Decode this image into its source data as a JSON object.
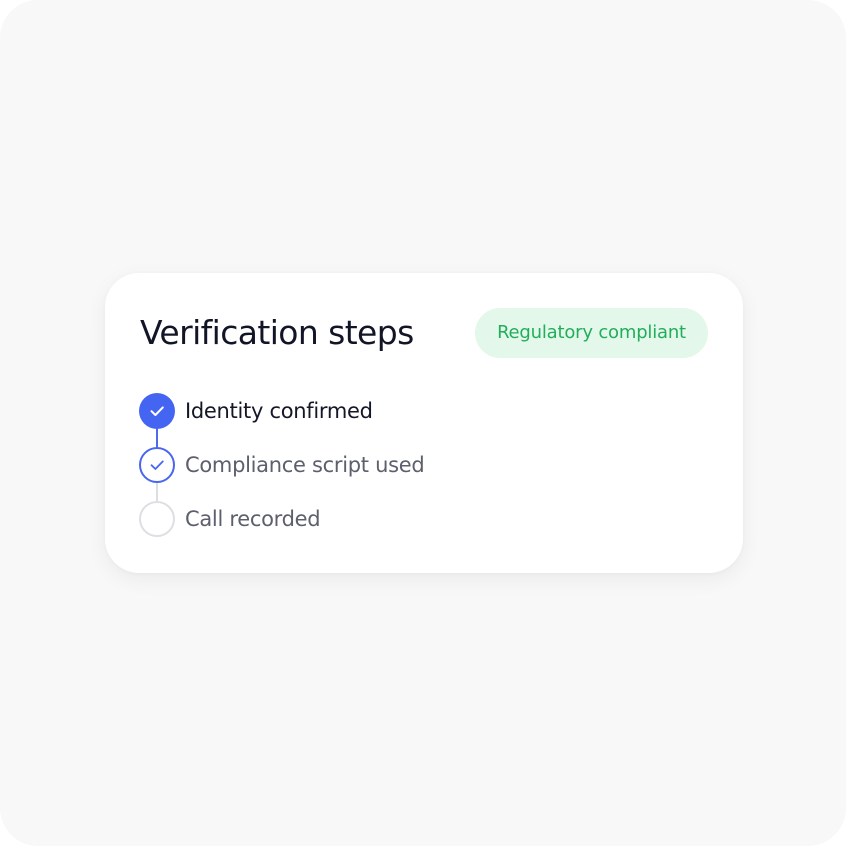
{
  "card": {
    "title": "Verification steps",
    "badge": "Regulatory compliant"
  },
  "steps": [
    {
      "label": "Identity confirmed",
      "status": "completed"
    },
    {
      "label": "Compliance script used",
      "status": "checked"
    },
    {
      "label": "Call recorded",
      "status": "pending"
    }
  ],
  "colors": {
    "accent": "#4465f2",
    "badge_bg": "#e3f8ea",
    "badge_text": "#22ad5c",
    "pending_border": "#dedfe3"
  },
  "icons": {
    "completed": "check-icon",
    "checked": "check-icon",
    "pending": "empty-circle"
  }
}
